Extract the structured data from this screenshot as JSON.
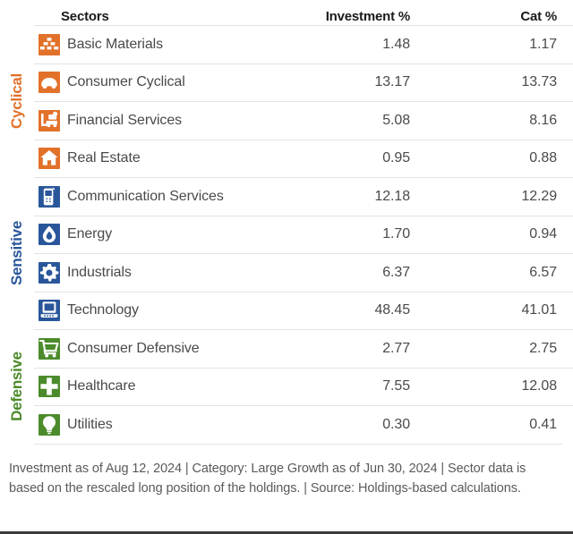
{
  "table": {
    "columns": {
      "sectors": "Sectors",
      "investment": "Investment  %",
      "category": "Cat  %"
    },
    "groups": [
      {
        "name": "Cyclical",
        "color": "#E2712A",
        "rows": [
          {
            "icon": "bricks-icon",
            "label": "Basic Materials",
            "investment": "1.48",
            "cat": "1.17"
          },
          {
            "icon": "car-icon",
            "label": "Consumer Cyclical",
            "investment": "13.17",
            "cat": "13.73"
          },
          {
            "icon": "bank-transfer-icon",
            "label": "Financial Services",
            "investment": "5.08",
            "cat": "8.16"
          },
          {
            "icon": "house-icon",
            "label": "Real Estate",
            "investment": "0.95",
            "cat": "0.88"
          }
        ]
      },
      {
        "name": "Sensitive",
        "color": "#29569A",
        "rows": [
          {
            "icon": "mobile-phone-icon",
            "label": "Communication Services",
            "investment": "12.18",
            "cat": "12.29"
          },
          {
            "icon": "flame-drop-icon",
            "label": "Energy",
            "investment": "1.70",
            "cat": "0.94"
          },
          {
            "icon": "gear-icon",
            "label": "Industrials",
            "investment": "6.37",
            "cat": "6.57"
          },
          {
            "icon": "computer-icon",
            "label": "Technology",
            "investment": "48.45",
            "cat": "41.01"
          }
        ]
      },
      {
        "name": "Defensive",
        "color": "#4C8B2B",
        "rows": [
          {
            "icon": "shopping-cart-icon",
            "label": "Consumer Defensive",
            "investment": "2.77",
            "cat": "2.75"
          },
          {
            "icon": "medical-cross-icon",
            "label": "Healthcare",
            "investment": "7.55",
            "cat": "12.08"
          },
          {
            "icon": "lightbulb-icon",
            "label": "Utilities",
            "investment": "0.30",
            "cat": "0.41"
          }
        ]
      }
    ]
  },
  "footnote": {
    "text": "Investment as of Aug 12, 2024 | Category: Large Growth as of Jun 30, 2024 | Sector data is based on the rescaled long position of the holdings. | Source: Holdings-based calculations."
  },
  "colors": {
    "cyclical": "#E2712A",
    "sensitive": "#29569A",
    "defensive": "#4C8B2B",
    "icon_orange": "#E8742A",
    "icon_blue": "#24609F",
    "icon_green": "#4C8B2B",
    "text": "#4a4a4a",
    "header_text": "#1a1a1a",
    "rule": "#e3e3e3"
  }
}
